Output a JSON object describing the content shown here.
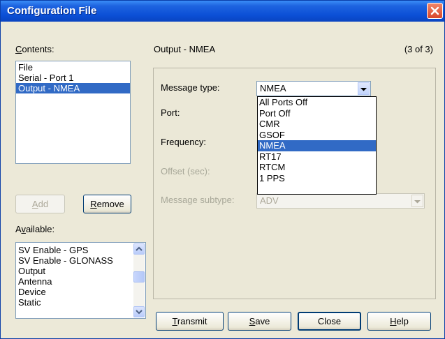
{
  "window": {
    "title": "Configuration File",
    "close_icon": "close-icon"
  },
  "contents": {
    "label_prefix": "",
    "label_key": "C",
    "label_rest": "ontents:",
    "items": [
      "File",
      "Serial - Port 1",
      "Output - NMEA"
    ],
    "selected_index": 2
  },
  "buttons": {
    "add_key": "A",
    "add_rest": "dd",
    "remove_key": "R",
    "remove_rest": "emove",
    "transmit_key": "T",
    "transmit_rest": "ransmit",
    "save_key": "S",
    "save_rest": "ave",
    "close_label": "Close",
    "help_key": "H",
    "help_rest": "elp"
  },
  "available": {
    "label_prefix": "A",
    "label_key": "v",
    "label_rest": "ailable:",
    "items": [
      "SV Enable - GPS",
      "SV Enable - GLONASS",
      "Output",
      "Antenna",
      "Device",
      "Static"
    ],
    "scroll_position": 0.1
  },
  "section": {
    "title": "Output - NMEA",
    "page_indicator": "(3 of 3)"
  },
  "fields": {
    "message_type_label": "Message type:",
    "message_type_value": "NMEA",
    "port_label": "Port:",
    "frequency_label": "Frequency:",
    "offset_label": "Offset (sec):",
    "message_subtype_label": "Message subtype:",
    "message_subtype_value": "ADV"
  },
  "dropdown": {
    "options": [
      "All Ports Off",
      "Port Off",
      "CMR",
      "GSOF",
      "NMEA",
      "RT17",
      "RTCM",
      "1 PPS"
    ],
    "selected_index": 4
  },
  "colors": {
    "selection": "#316ac5",
    "titlebar": "#0b4fd6"
  }
}
